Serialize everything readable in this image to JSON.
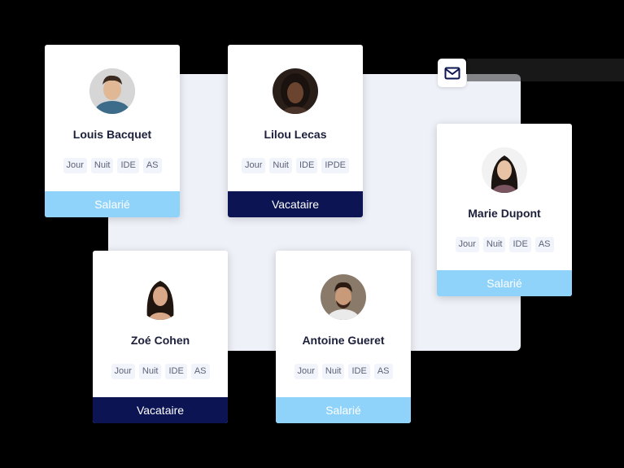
{
  "cards": [
    {
      "name": "Louis Bacquet",
      "tags": [
        "Jour",
        "Nuit",
        "IDE",
        "AS"
      ],
      "status": "Salarié",
      "status_type": "salarie"
    },
    {
      "name": "Lilou Lecas",
      "tags": [
        "Jour",
        "Nuit",
        "IDE",
        "IPDE"
      ],
      "status": "Vacataire",
      "status_type": "vacataire"
    },
    {
      "name": "Marie Dupont",
      "tags": [
        "Jour",
        "Nuit",
        "IDE",
        "AS"
      ],
      "status": "Salarié",
      "status_type": "salarie"
    },
    {
      "name": "Zoé Cohen",
      "tags": [
        "Jour",
        "Nuit",
        "IDE",
        "AS"
      ],
      "status": "Vacataire",
      "status_type": "vacataire"
    },
    {
      "name": "Antoine Gueret",
      "tags": [
        "Jour",
        "Nuit",
        "IDE",
        "AS"
      ],
      "status": "Salarié",
      "status_type": "salarie"
    }
  ],
  "icons": {
    "mail": "mail-icon"
  },
  "colors": {
    "salarie": "#8fd3fb",
    "vacataire": "#0c1453",
    "backdrop": "#eef1f8"
  }
}
